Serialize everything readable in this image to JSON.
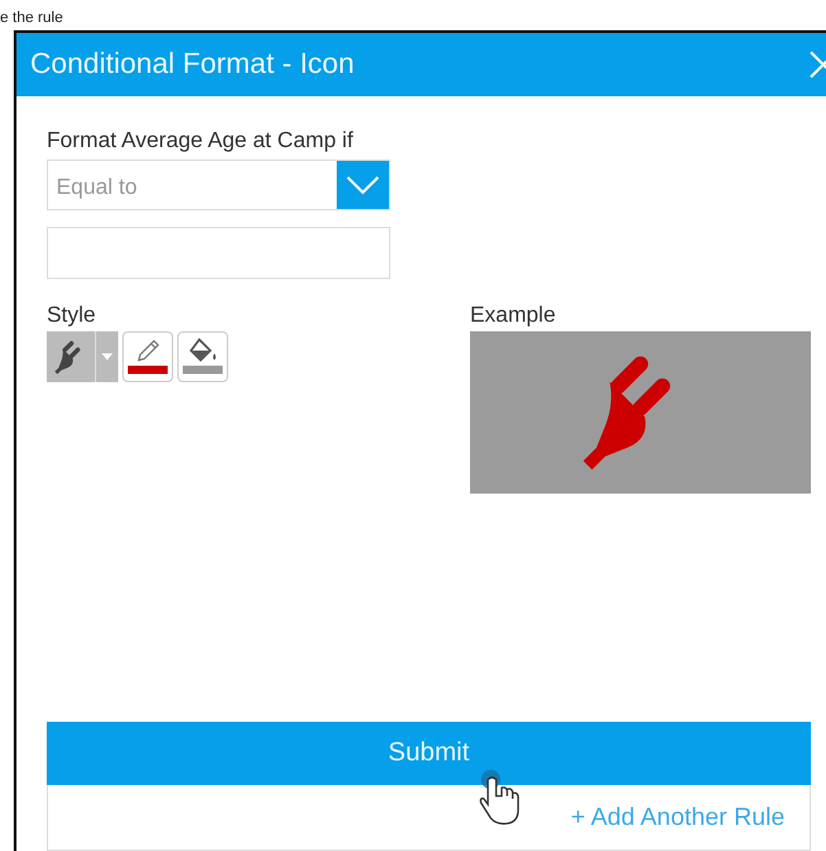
{
  "intro_text": "e the rule",
  "dialog": {
    "title": "Conditional Format - Icon"
  },
  "condition": {
    "label": "Format Average Age at Camp if",
    "operator": "Equal to"
  },
  "style": {
    "label": "Style",
    "tools": [
      {
        "kind": "icon-picker"
      },
      {
        "kind": "font-color",
        "color": "#cc0000"
      },
      {
        "kind": "fill-color",
        "color": "#999999"
      }
    ]
  },
  "example": {
    "label": "Example"
  },
  "submit": "Submit",
  "add_rule": "+ Add Another Rule"
}
